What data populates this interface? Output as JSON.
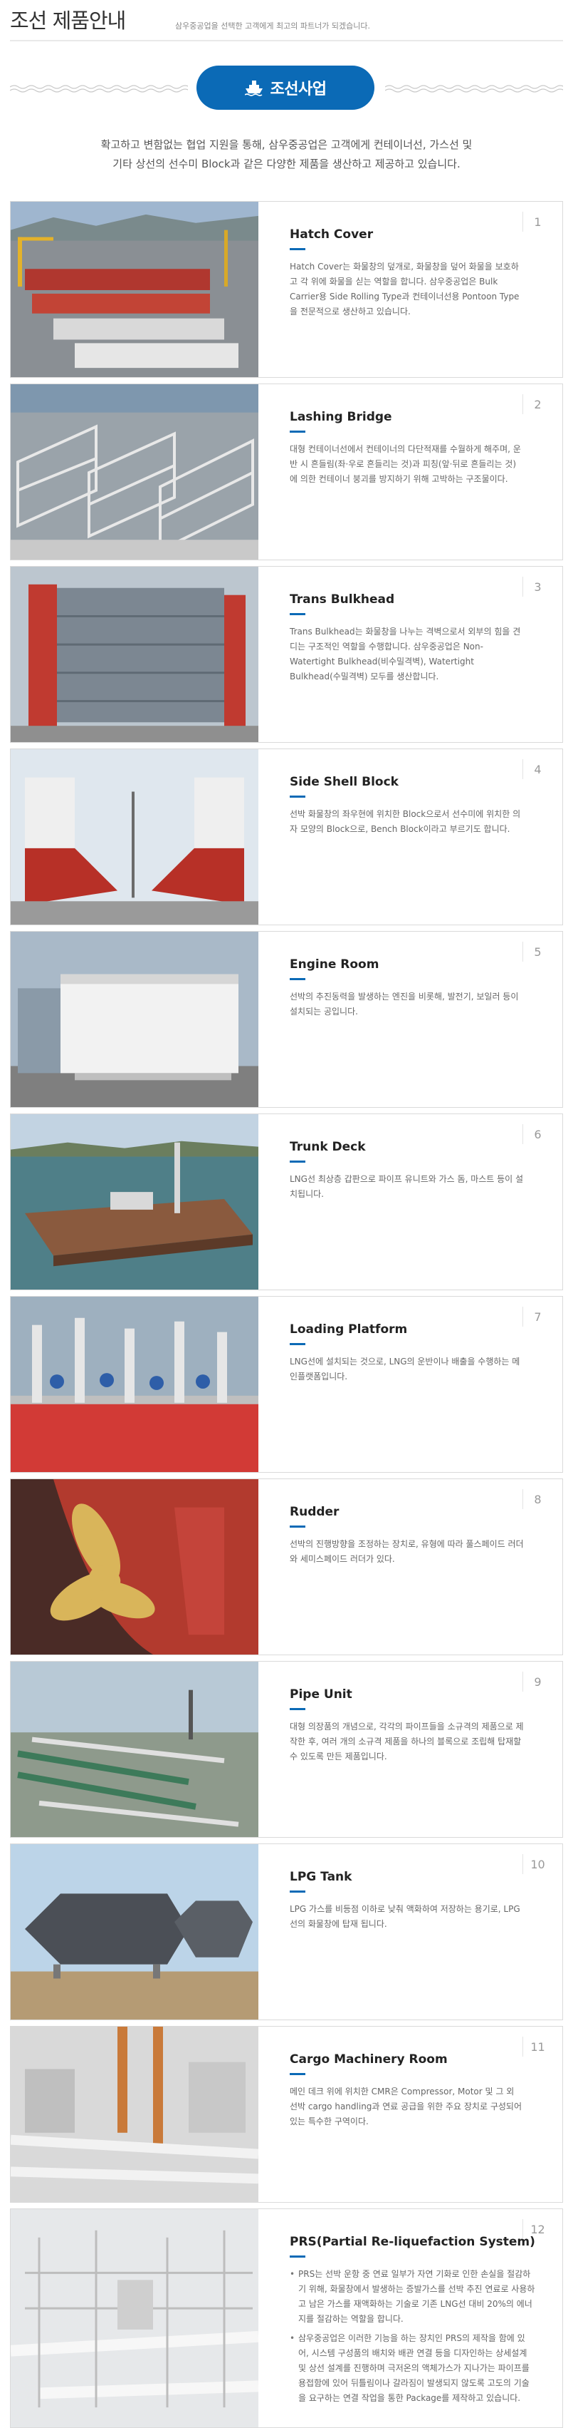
{
  "header": {
    "title": "조선 제품안내",
    "subtitle": "삼우중공업을 선택한 고객에게 최고의 파트너가 되겠습니다."
  },
  "section": {
    "label": "조선사업",
    "icon": "ship-icon",
    "accent_color": "#0b6ab6"
  },
  "intro": {
    "line1": "확고하고 변함없는 협업 지원을 통해, 삼우중공업은 고객에게 컨테이너선, 가스선 및",
    "line2": "기타 상선의 선수미 Block과 같은 다양한 제품을 생산하고 제공하고 있습니다."
  },
  "products": [
    {
      "num": "1",
      "name": "Hatch Cover",
      "desc": "Hatch Cover는 화물창의 덮개로, 화물창을 덮어 화물을 보호하고 각 위에 화물을 싣는 역할을 합니다. 삼우중공업은 Bulk Carrier용 Side Rolling Type과 컨테이너선용 Pontoon Type을 전문적으로 생산하고 있습니다."
    },
    {
      "num": "2",
      "name": "Lashing Bridge",
      "desc": "대형 컨테이너선에서 컨테이너의 다단적재를 수월하게 해주며, 운반 시 흔들림(좌·우로 흔들리는 것)과 피칭(앞·뒤로 흔들리는 것)에 의한 컨테이너 붕괴를 방지하기 위해 고박하는 구조물이다."
    },
    {
      "num": "3",
      "name": "Trans Bulkhead",
      "desc": "Trans Bulkhead는 화물창을 나누는 격벽으로서 외부의 힘을 견디는 구조적인 역할을 수행합니다. 삼우중공업은 Non-Watertight Bulkhead(비수밀격벽), Watertight Bulkhead(수밀격벽) 모두를 생산합니다."
    },
    {
      "num": "4",
      "name": "Side Shell Block",
      "desc": "선박 화물창의 좌우현에 위치한 Block으로서 선수미에 위치한 의자 모양의 Block으로, Bench Block이라고 부르기도 합니다."
    },
    {
      "num": "5",
      "name": "Engine Room",
      "desc": "선박의 추진동력을 발생하는 엔진을 비롯해, 발전기, 보일러 등이 설치되는 공입니다."
    },
    {
      "num": "6",
      "name": "Trunk Deck",
      "desc": "LNG선 최상층 갑판으로 파이프 유니트와 가스 돔, 마스트 등이 설치됩니다."
    },
    {
      "num": "7",
      "name": "Loading Platform",
      "desc": "LNG선에 설치되는 것으로, LNG의 운반이나 배출을 수행하는 메인플랫폼입니다."
    },
    {
      "num": "8",
      "name": "Rudder",
      "desc": "선박의 진행방향을 조정하는 장치로, 유형에 따라 풀스페이드 러더와 세미스페이드 러더가 있다."
    },
    {
      "num": "9",
      "name": "Pipe Unit",
      "desc": "대형 의장품의 개념으로, 각각의 파이프들을 소규격의 제품으로 제작한 후, 여러 개의 소규격 제품을 하나의 블록으로 조립해 탑재할 수 있도록 만든 제품입니다."
    },
    {
      "num": "10",
      "name": "LPG Tank",
      "desc": "LPG 가스를 비등점 이하로 낮춰 액화하여 저장하는 용기로, LPG선의 화물창에 탑재 됩니다."
    },
    {
      "num": "11",
      "name": "Cargo Machinery Room",
      "desc": "메인 데크 위에 위치한 CMR은 Compressor, Motor 및 그 외 선박 cargo handling과 연료 공급을 위한 주요 장치로 구성되어 있는 특수한 구역이다."
    },
    {
      "num": "12",
      "name": "PRS(Partial Re-liquefaction System)",
      "bullets": [
        "PRS는 선박 운항 중 연료 일부가 자연 기화로 인한 손실을 절감하기 위해, 화물창에서 발생하는 증발가스를 선박 추진 연료로 사용하고 남은 가스를 재액화하는 기술로 기존 LNG선 대비 20%의 에너지를 절감하는 역할을 합니다.",
        "삼우중공업은 이러한 기능을 하는 장치인 PRS의 제작을 함에 있어, 시스템 구성품의 배치와 배관 연결 등을 디자인하는 상세설계 및 상선 설계를 진행하며 극저온의 액체가스가 지나가는 파이프를 용접함에 있어 뒤틀림이나 갈라짐이 발생되지 않도록 고도의 기술을 요구하는 연결 작업을 통한 Package를 제작하고 있습니다."
      ]
    }
  ]
}
